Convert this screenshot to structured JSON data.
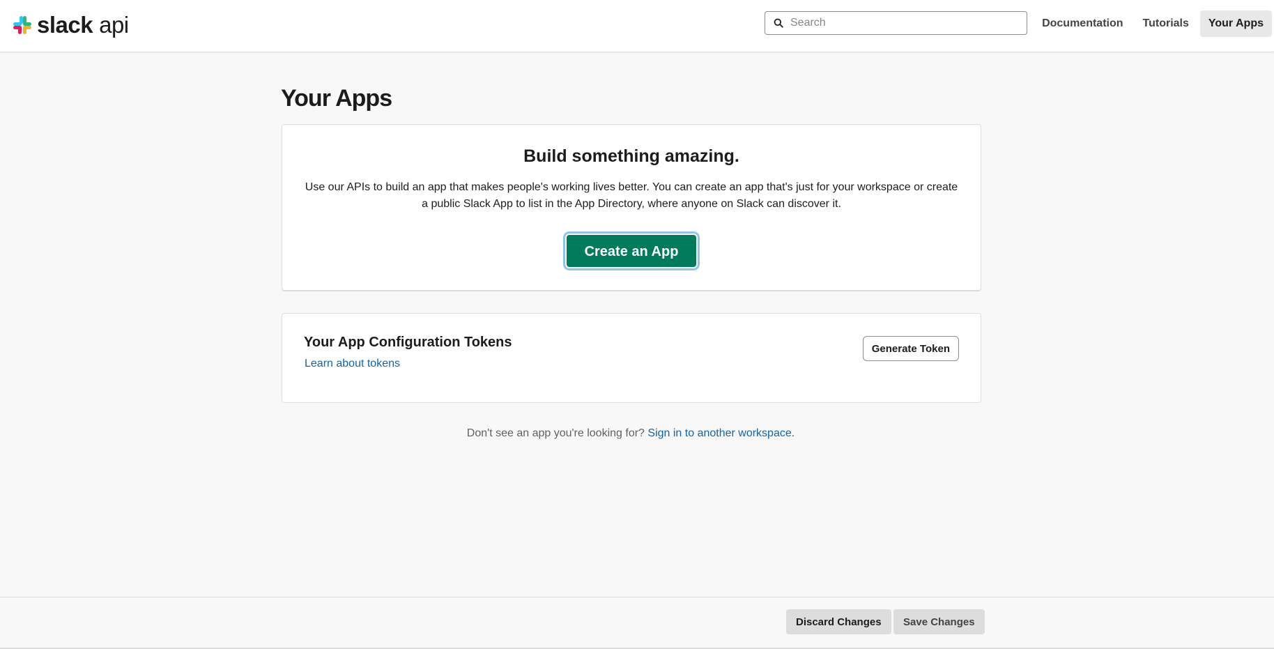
{
  "header": {
    "logo": {
      "bold": "slack",
      "light": "api"
    },
    "search": {
      "placeholder": "Search",
      "value": ""
    },
    "nav": [
      {
        "label": "Documentation"
      },
      {
        "label": "Tutorials"
      },
      {
        "label": "Your Apps",
        "active": true
      }
    ]
  },
  "main": {
    "title": "Your Apps",
    "build_card": {
      "heading": "Build something amazing.",
      "description": "Use our APIs to build an app that makes people's working lives better. You can create an app that's just for your workspace or create a public Slack App to list in the App Directory, where anyone on Slack can discover it.",
      "button": "Create an App"
    },
    "tokens_card": {
      "heading": "Your App Configuration Tokens",
      "link": "Learn about tokens",
      "button": "Generate Token"
    },
    "signin": {
      "prefix": "Don't see an app you're looking for?",
      "link": "Sign in to another workspace."
    }
  },
  "footer": {
    "discard": "Discard Changes",
    "save": "Save Changes"
  },
  "colors": {
    "accent_green": "#007a5a",
    "link_blue": "#1264a3",
    "page_bg": "#f8f8f8"
  }
}
